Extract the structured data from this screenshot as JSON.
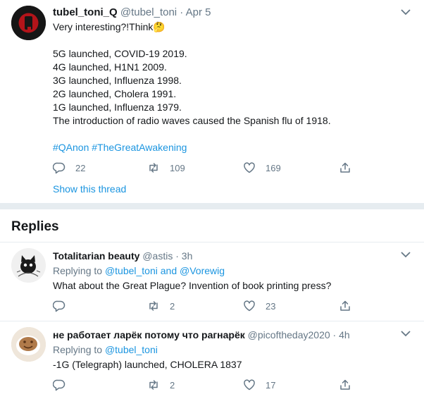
{
  "main_tweet": {
    "display_name": "tubel_toni_Q",
    "handle": "@tubel_toni",
    "dot": "·",
    "date": "Apr 5",
    "lines": [
      "Very interesting?!Think🤔",
      "5G launched, COVID-19 2019.",
      "4G launched, H1N1 2009.",
      "3G launched, Influenza 1998.",
      "2G launched, Cholera 1991.",
      "1G launched, Influenza 1979.",
      "The introduction of radio waves caused the Spanish flu of 1918."
    ],
    "hashtags": "#QAnon #TheGreatAwakening",
    "reply_count": "22",
    "retweet_count": "109",
    "like_count": "169",
    "show_thread": "Show this thread"
  },
  "replies_heading": "Replies",
  "replies": [
    {
      "display_name": "Totalitarian beauty",
      "handle": "@astis",
      "dot": "·",
      "time": "3h",
      "replying_prefix": "Replying to",
      "replying_to": "@tubel_toni and @Vorewig",
      "text": "What about the Great Plague? Invention of book printing press?",
      "reply_count": "",
      "retweet_count": "2",
      "like_count": "23"
    },
    {
      "display_name": "не работает ларёк потому что рагнарёк",
      "handle": "@picoftheday2020",
      "dot": "·",
      "time": "4h",
      "replying_prefix": "Replying to",
      "replying_to": "@tubel_toni",
      "text": "-1G (Telegraph) launched, CHOLERA 1837",
      "reply_count": "",
      "retweet_count": "2",
      "like_count": "17"
    }
  ],
  "colors": {
    "link": "#1b95e0",
    "muted": "#657786",
    "divider": "#e6ecf0",
    "text": "#14171a"
  }
}
